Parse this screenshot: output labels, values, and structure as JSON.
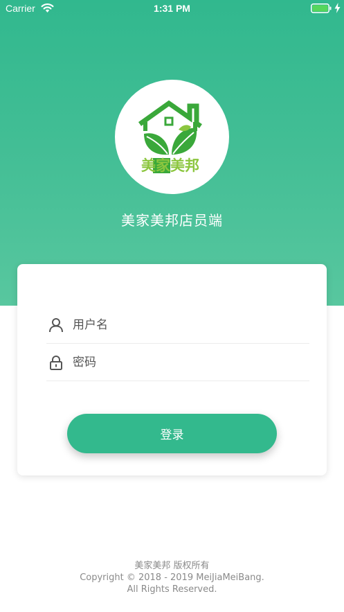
{
  "status_bar": {
    "carrier": "Carrier",
    "time": "1:31 PM",
    "wifi_icon": "wifi-icon",
    "battery_icon": "battery-icon",
    "charging_icon": "bolt-icon"
  },
  "header": {
    "logo_text": "美家美邦",
    "title": "美家美邦店员端"
  },
  "login_form": {
    "username_placeholder": "用户名",
    "password_placeholder": "密码",
    "username_icon": "user-icon",
    "password_icon": "lock-icon",
    "submit_label": "登录"
  },
  "footer": {
    "line1": "美家美邦 版权所有",
    "line2": "Copyright © 2018 - 2019 MeiJiaMeiBang.",
    "line3": "All Rights Reserved."
  },
  "colors": {
    "primary": "#33b98d",
    "logo_green": "#3aa83a",
    "logo_lime": "#8cc63f"
  }
}
